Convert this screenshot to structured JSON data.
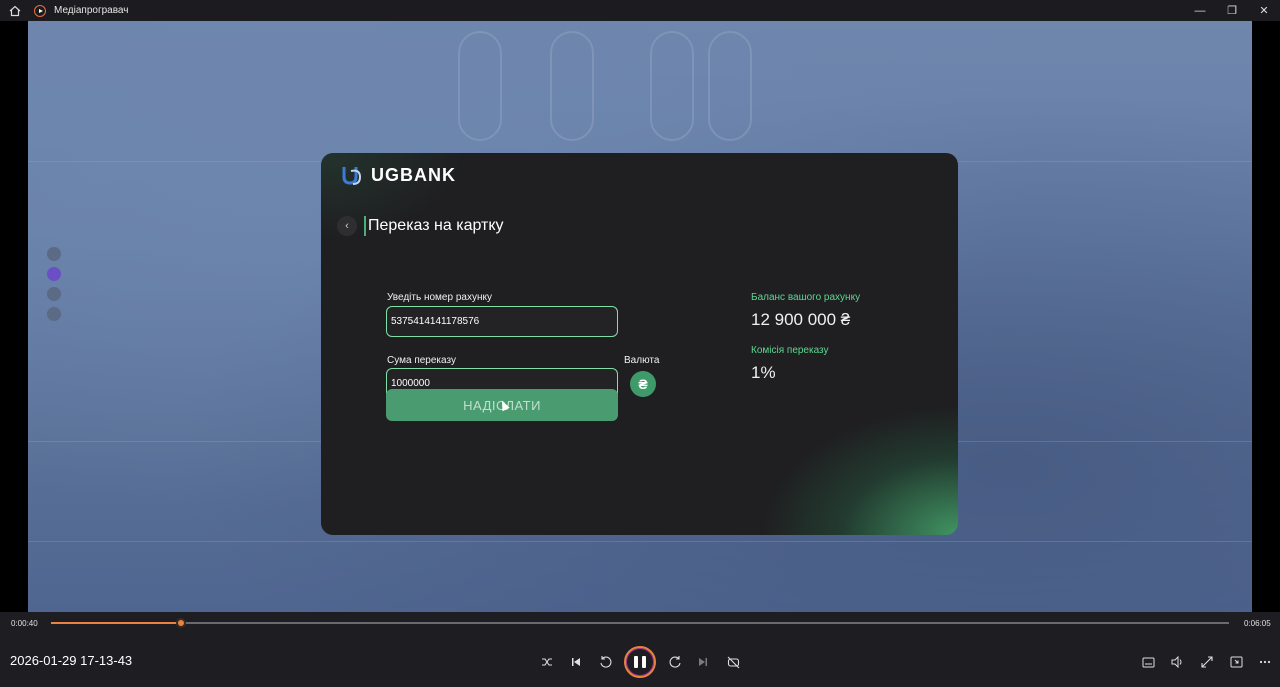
{
  "titlebar": {
    "app_title": "Медіапрогравач",
    "home_icon": "home-icon",
    "app_icon": "media-player-icon",
    "minimize": "—",
    "restore": "❐",
    "close": "✕"
  },
  "bank": {
    "logo_text": "UGBANK",
    "back_symbol": "‹",
    "page_title": "Переказ на картку",
    "account_label": "Уведіть номер рахунку",
    "account_value": "5375414141178576",
    "amount_label": "Сума переказу",
    "amount_value": "1000000",
    "currency_label": "Валюта",
    "currency_symbol": "₴",
    "pay_button": "НАДІСЛАТИ",
    "balance_label": "Баланс вашого рахунку",
    "balance_value": "12 900 000 ₴",
    "fee_label": "Комісія переказу",
    "fee_value": "1%",
    "colors": {
      "accent_green": "#5fd592",
      "button_green": "#4b9b70",
      "panel_bg": "#1f1f21"
    }
  },
  "player": {
    "elapsed": "0:00:40",
    "duration": "0:06:05",
    "progress_percent": 11,
    "media_title": "2026-01-29 17-13-43",
    "accent": "#e9833f"
  }
}
